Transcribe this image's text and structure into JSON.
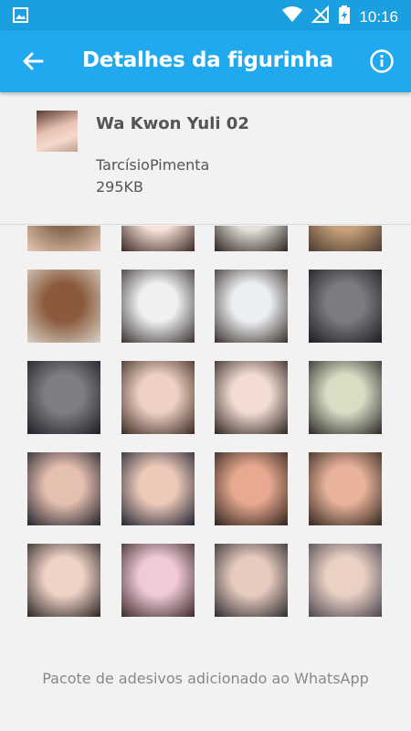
{
  "status_bar": {
    "time": "10:16",
    "icons": [
      "image-icon",
      "wifi-icon",
      "no-signal-icon",
      "battery-charging-icon"
    ]
  },
  "app_bar": {
    "title": "Detalhes da figurinha",
    "back_icon": "arrow-left-icon",
    "info_icon": "info-icon"
  },
  "pack": {
    "name": "Wa Kwon Yuli 02",
    "author": "TarcísioPimenta",
    "size": "295KB"
  },
  "stickers": {
    "count_visible": 20,
    "colors": [
      [
        "#8a6a50",
        "#e8c7b5"
      ],
      [
        "#f7e3d8",
        "#3a2a24"
      ],
      [
        "#e4e0da",
        "#2d241e"
      ],
      [
        "#c9a27a",
        "#4a3a32"
      ],
      [
        "#8b5a3c",
        "#d9d2c8"
      ],
      [
        "#eef0f2",
        "#3b3230"
      ],
      [
        "#eceff2",
        "#3b302b"
      ],
      [
        "#7a7c80",
        "#1c1c20"
      ],
      [
        "#7d7f84",
        "#1e1f26"
      ],
      [
        "#efd0c4",
        "#3a2a22"
      ],
      [
        "#f3ddd2",
        "#2e2420"
      ],
      [
        "#d8ddc4",
        "#2b2727"
      ],
      [
        "#e5bfb0",
        "#23222c"
      ],
      [
        "#ecc9b9",
        "#222433"
      ],
      [
        "#e7a98f",
        "#2f221d"
      ],
      [
        "#e9b39b",
        "#33261f"
      ],
      [
        "#f0d3c7",
        "#2a2422"
      ],
      [
        "#f0cad6",
        "#3a2a2a"
      ],
      [
        "#e7cbbf",
        "#2c2b2e"
      ],
      [
        "#ead1c4",
        "#4a4550"
      ]
    ]
  },
  "footer": {
    "message": "Pacote de adesivos adicionado ao WhatsApp"
  },
  "colors": {
    "status_bar": "#1a9fe0",
    "app_bar": "#21a9f0",
    "background": "#f2f2f2"
  }
}
